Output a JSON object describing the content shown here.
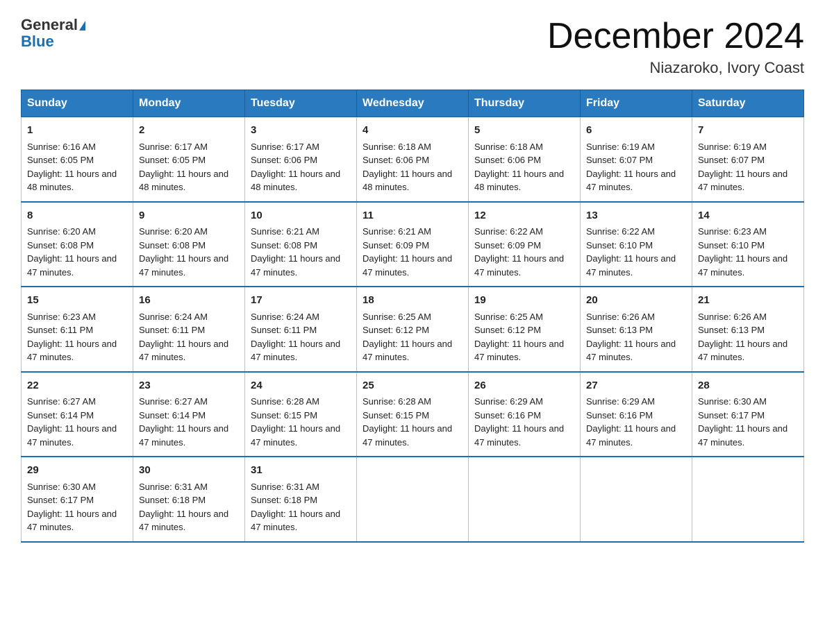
{
  "logo": {
    "line1": "General",
    "line2": "Blue"
  },
  "title": "December 2024",
  "location": "Niazaroko, Ivory Coast",
  "days_of_week": [
    "Sunday",
    "Monday",
    "Tuesday",
    "Wednesday",
    "Thursday",
    "Friday",
    "Saturday"
  ],
  "weeks": [
    [
      {
        "day": "1",
        "sunrise": "6:16 AM",
        "sunset": "6:05 PM",
        "daylight": "11 hours and 48 minutes."
      },
      {
        "day": "2",
        "sunrise": "6:17 AM",
        "sunset": "6:05 PM",
        "daylight": "11 hours and 48 minutes."
      },
      {
        "day": "3",
        "sunrise": "6:17 AM",
        "sunset": "6:06 PM",
        "daylight": "11 hours and 48 minutes."
      },
      {
        "day": "4",
        "sunrise": "6:18 AM",
        "sunset": "6:06 PM",
        "daylight": "11 hours and 48 minutes."
      },
      {
        "day": "5",
        "sunrise": "6:18 AM",
        "sunset": "6:06 PM",
        "daylight": "11 hours and 48 minutes."
      },
      {
        "day": "6",
        "sunrise": "6:19 AM",
        "sunset": "6:07 PM",
        "daylight": "11 hours and 47 minutes."
      },
      {
        "day": "7",
        "sunrise": "6:19 AM",
        "sunset": "6:07 PM",
        "daylight": "11 hours and 47 minutes."
      }
    ],
    [
      {
        "day": "8",
        "sunrise": "6:20 AM",
        "sunset": "6:08 PM",
        "daylight": "11 hours and 47 minutes."
      },
      {
        "day": "9",
        "sunrise": "6:20 AM",
        "sunset": "6:08 PM",
        "daylight": "11 hours and 47 minutes."
      },
      {
        "day": "10",
        "sunrise": "6:21 AM",
        "sunset": "6:08 PM",
        "daylight": "11 hours and 47 minutes."
      },
      {
        "day": "11",
        "sunrise": "6:21 AM",
        "sunset": "6:09 PM",
        "daylight": "11 hours and 47 minutes."
      },
      {
        "day": "12",
        "sunrise": "6:22 AM",
        "sunset": "6:09 PM",
        "daylight": "11 hours and 47 minutes."
      },
      {
        "day": "13",
        "sunrise": "6:22 AM",
        "sunset": "6:10 PM",
        "daylight": "11 hours and 47 minutes."
      },
      {
        "day": "14",
        "sunrise": "6:23 AM",
        "sunset": "6:10 PM",
        "daylight": "11 hours and 47 minutes."
      }
    ],
    [
      {
        "day": "15",
        "sunrise": "6:23 AM",
        "sunset": "6:11 PM",
        "daylight": "11 hours and 47 minutes."
      },
      {
        "day": "16",
        "sunrise": "6:24 AM",
        "sunset": "6:11 PM",
        "daylight": "11 hours and 47 minutes."
      },
      {
        "day": "17",
        "sunrise": "6:24 AM",
        "sunset": "6:11 PM",
        "daylight": "11 hours and 47 minutes."
      },
      {
        "day": "18",
        "sunrise": "6:25 AM",
        "sunset": "6:12 PM",
        "daylight": "11 hours and 47 minutes."
      },
      {
        "day": "19",
        "sunrise": "6:25 AM",
        "sunset": "6:12 PM",
        "daylight": "11 hours and 47 minutes."
      },
      {
        "day": "20",
        "sunrise": "6:26 AM",
        "sunset": "6:13 PM",
        "daylight": "11 hours and 47 minutes."
      },
      {
        "day": "21",
        "sunrise": "6:26 AM",
        "sunset": "6:13 PM",
        "daylight": "11 hours and 47 minutes."
      }
    ],
    [
      {
        "day": "22",
        "sunrise": "6:27 AM",
        "sunset": "6:14 PM",
        "daylight": "11 hours and 47 minutes."
      },
      {
        "day": "23",
        "sunrise": "6:27 AM",
        "sunset": "6:14 PM",
        "daylight": "11 hours and 47 minutes."
      },
      {
        "day": "24",
        "sunrise": "6:28 AM",
        "sunset": "6:15 PM",
        "daylight": "11 hours and 47 minutes."
      },
      {
        "day": "25",
        "sunrise": "6:28 AM",
        "sunset": "6:15 PM",
        "daylight": "11 hours and 47 minutes."
      },
      {
        "day": "26",
        "sunrise": "6:29 AM",
        "sunset": "6:16 PM",
        "daylight": "11 hours and 47 minutes."
      },
      {
        "day": "27",
        "sunrise": "6:29 AM",
        "sunset": "6:16 PM",
        "daylight": "11 hours and 47 minutes."
      },
      {
        "day": "28",
        "sunrise": "6:30 AM",
        "sunset": "6:17 PM",
        "daylight": "11 hours and 47 minutes."
      }
    ],
    [
      {
        "day": "29",
        "sunrise": "6:30 AM",
        "sunset": "6:17 PM",
        "daylight": "11 hours and 47 minutes."
      },
      {
        "day": "30",
        "sunrise": "6:31 AM",
        "sunset": "6:18 PM",
        "daylight": "11 hours and 47 minutes."
      },
      {
        "day": "31",
        "sunrise": "6:31 AM",
        "sunset": "6:18 PM",
        "daylight": "11 hours and 47 minutes."
      },
      {
        "day": "",
        "sunrise": "",
        "sunset": "",
        "daylight": ""
      },
      {
        "day": "",
        "sunrise": "",
        "sunset": "",
        "daylight": ""
      },
      {
        "day": "",
        "sunrise": "",
        "sunset": "",
        "daylight": ""
      },
      {
        "day": "",
        "sunrise": "",
        "sunset": "",
        "daylight": ""
      }
    ]
  ]
}
